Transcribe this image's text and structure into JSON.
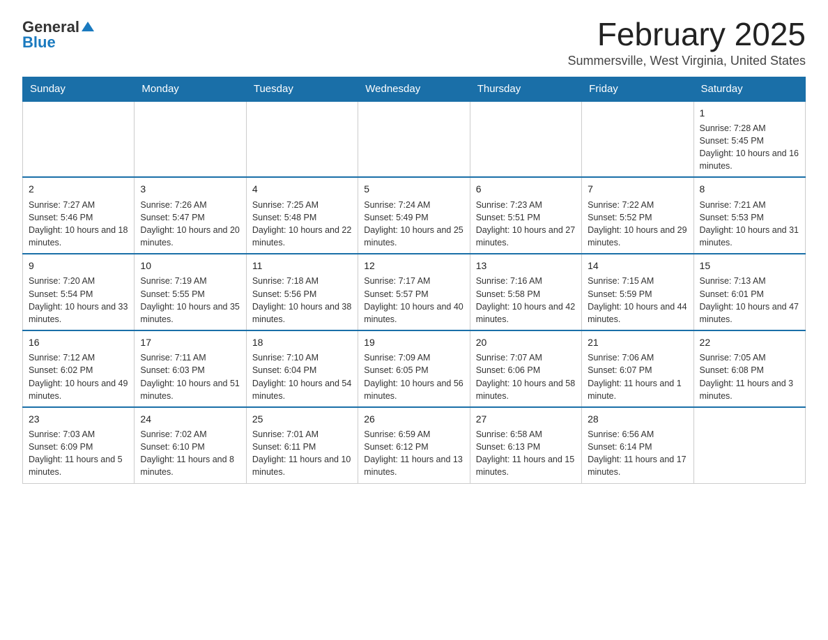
{
  "logo": {
    "general": "General",
    "blue": "Blue"
  },
  "title": {
    "month_year": "February 2025",
    "location": "Summersville, West Virginia, United States"
  },
  "days_of_week": [
    "Sunday",
    "Monday",
    "Tuesday",
    "Wednesday",
    "Thursday",
    "Friday",
    "Saturday"
  ],
  "weeks": [
    [
      {
        "day": "",
        "info": ""
      },
      {
        "day": "",
        "info": ""
      },
      {
        "day": "",
        "info": ""
      },
      {
        "day": "",
        "info": ""
      },
      {
        "day": "",
        "info": ""
      },
      {
        "day": "",
        "info": ""
      },
      {
        "day": "1",
        "info": "Sunrise: 7:28 AM\nSunset: 5:45 PM\nDaylight: 10 hours and 16 minutes."
      }
    ],
    [
      {
        "day": "2",
        "info": "Sunrise: 7:27 AM\nSunset: 5:46 PM\nDaylight: 10 hours and 18 minutes."
      },
      {
        "day": "3",
        "info": "Sunrise: 7:26 AM\nSunset: 5:47 PM\nDaylight: 10 hours and 20 minutes."
      },
      {
        "day": "4",
        "info": "Sunrise: 7:25 AM\nSunset: 5:48 PM\nDaylight: 10 hours and 22 minutes."
      },
      {
        "day": "5",
        "info": "Sunrise: 7:24 AM\nSunset: 5:49 PM\nDaylight: 10 hours and 25 minutes."
      },
      {
        "day": "6",
        "info": "Sunrise: 7:23 AM\nSunset: 5:51 PM\nDaylight: 10 hours and 27 minutes."
      },
      {
        "day": "7",
        "info": "Sunrise: 7:22 AM\nSunset: 5:52 PM\nDaylight: 10 hours and 29 minutes."
      },
      {
        "day": "8",
        "info": "Sunrise: 7:21 AM\nSunset: 5:53 PM\nDaylight: 10 hours and 31 minutes."
      }
    ],
    [
      {
        "day": "9",
        "info": "Sunrise: 7:20 AM\nSunset: 5:54 PM\nDaylight: 10 hours and 33 minutes."
      },
      {
        "day": "10",
        "info": "Sunrise: 7:19 AM\nSunset: 5:55 PM\nDaylight: 10 hours and 35 minutes."
      },
      {
        "day": "11",
        "info": "Sunrise: 7:18 AM\nSunset: 5:56 PM\nDaylight: 10 hours and 38 minutes."
      },
      {
        "day": "12",
        "info": "Sunrise: 7:17 AM\nSunset: 5:57 PM\nDaylight: 10 hours and 40 minutes."
      },
      {
        "day": "13",
        "info": "Sunrise: 7:16 AM\nSunset: 5:58 PM\nDaylight: 10 hours and 42 minutes."
      },
      {
        "day": "14",
        "info": "Sunrise: 7:15 AM\nSunset: 5:59 PM\nDaylight: 10 hours and 44 minutes."
      },
      {
        "day": "15",
        "info": "Sunrise: 7:13 AM\nSunset: 6:01 PM\nDaylight: 10 hours and 47 minutes."
      }
    ],
    [
      {
        "day": "16",
        "info": "Sunrise: 7:12 AM\nSunset: 6:02 PM\nDaylight: 10 hours and 49 minutes."
      },
      {
        "day": "17",
        "info": "Sunrise: 7:11 AM\nSunset: 6:03 PM\nDaylight: 10 hours and 51 minutes."
      },
      {
        "day": "18",
        "info": "Sunrise: 7:10 AM\nSunset: 6:04 PM\nDaylight: 10 hours and 54 minutes."
      },
      {
        "day": "19",
        "info": "Sunrise: 7:09 AM\nSunset: 6:05 PM\nDaylight: 10 hours and 56 minutes."
      },
      {
        "day": "20",
        "info": "Sunrise: 7:07 AM\nSunset: 6:06 PM\nDaylight: 10 hours and 58 minutes."
      },
      {
        "day": "21",
        "info": "Sunrise: 7:06 AM\nSunset: 6:07 PM\nDaylight: 11 hours and 1 minute."
      },
      {
        "day": "22",
        "info": "Sunrise: 7:05 AM\nSunset: 6:08 PM\nDaylight: 11 hours and 3 minutes."
      }
    ],
    [
      {
        "day": "23",
        "info": "Sunrise: 7:03 AM\nSunset: 6:09 PM\nDaylight: 11 hours and 5 minutes."
      },
      {
        "day": "24",
        "info": "Sunrise: 7:02 AM\nSunset: 6:10 PM\nDaylight: 11 hours and 8 minutes."
      },
      {
        "day": "25",
        "info": "Sunrise: 7:01 AM\nSunset: 6:11 PM\nDaylight: 11 hours and 10 minutes."
      },
      {
        "day": "26",
        "info": "Sunrise: 6:59 AM\nSunset: 6:12 PM\nDaylight: 11 hours and 13 minutes."
      },
      {
        "day": "27",
        "info": "Sunrise: 6:58 AM\nSunset: 6:13 PM\nDaylight: 11 hours and 15 minutes."
      },
      {
        "day": "28",
        "info": "Sunrise: 6:56 AM\nSunset: 6:14 PM\nDaylight: 11 hours and 17 minutes."
      },
      {
        "day": "",
        "info": ""
      }
    ]
  ]
}
